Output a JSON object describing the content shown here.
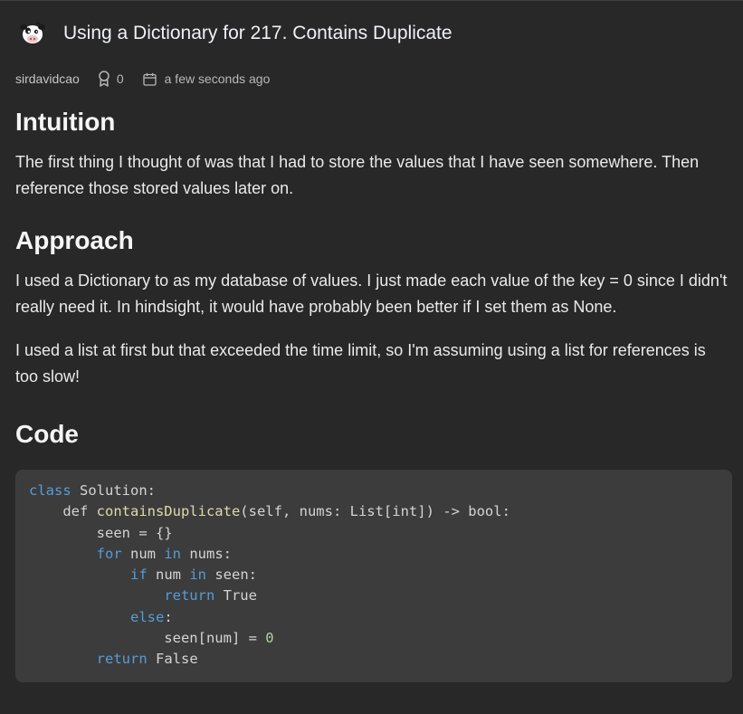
{
  "post": {
    "title": "Using a Dictionary for 217. Contains Duplicate",
    "author": "sirdavidcao",
    "votes": "0",
    "date": "a few seconds ago"
  },
  "sections": {
    "intuition": {
      "heading": "Intuition",
      "paragraphs": [
        "The first thing I thought of was that I had to store the values that I have seen somewhere. Then reference those stored values later on."
      ]
    },
    "approach": {
      "heading": "Approach",
      "paragraphs": [
        "I used a Dictionary to as my database of values. I just made each value of the key = 0 since I didn't really need it. In hindsight, it would have probably been better if I set them as None.",
        "I used a list at first but that exceeded the time limit, so I'm assuming using a list for references is too slow!"
      ]
    },
    "code": {
      "heading": "Code",
      "lines": [
        [
          {
            "t": "kw",
            "v": "class"
          },
          {
            "t": "plain",
            "v": " Solution:"
          }
        ],
        [
          {
            "t": "plain",
            "v": "    def "
          },
          {
            "t": "fn",
            "v": "containsDuplicate"
          },
          {
            "t": "plain",
            "v": "(self, nums: List[int]) -> bool:"
          }
        ],
        [
          {
            "t": "plain",
            "v": "        seen = {}"
          }
        ],
        [
          {
            "t": "plain",
            "v": "        "
          },
          {
            "t": "kw",
            "v": "for"
          },
          {
            "t": "plain",
            "v": " num "
          },
          {
            "t": "kw",
            "v": "in"
          },
          {
            "t": "plain",
            "v": " nums:"
          }
        ],
        [
          {
            "t": "plain",
            "v": "            "
          },
          {
            "t": "kw",
            "v": "if"
          },
          {
            "t": "plain",
            "v": " num "
          },
          {
            "t": "kw",
            "v": "in"
          },
          {
            "t": "plain",
            "v": " seen:"
          }
        ],
        [
          {
            "t": "plain",
            "v": "                "
          },
          {
            "t": "kw",
            "v": "return"
          },
          {
            "t": "plain",
            "v": " True"
          }
        ],
        [
          {
            "t": "plain",
            "v": "            "
          },
          {
            "t": "kw",
            "v": "else"
          },
          {
            "t": "plain",
            "v": ":"
          }
        ],
        [
          {
            "t": "plain",
            "v": "                seen[num] = "
          },
          {
            "t": "num",
            "v": "0"
          }
        ],
        [
          {
            "t": "plain",
            "v": "        "
          },
          {
            "t": "kw",
            "v": "return"
          },
          {
            "t": "plain",
            "v": " False"
          }
        ]
      ]
    }
  },
  "icons": {
    "avatar": "cow-avatar-icon",
    "votes": "award-ribbon-icon",
    "date": "calendar-icon"
  },
  "colors": {
    "background": "#282828",
    "code_background": "#3c3c3c",
    "keyword": "#569cd6",
    "function": "#dcdcaa",
    "number": "#b5cea8"
  }
}
